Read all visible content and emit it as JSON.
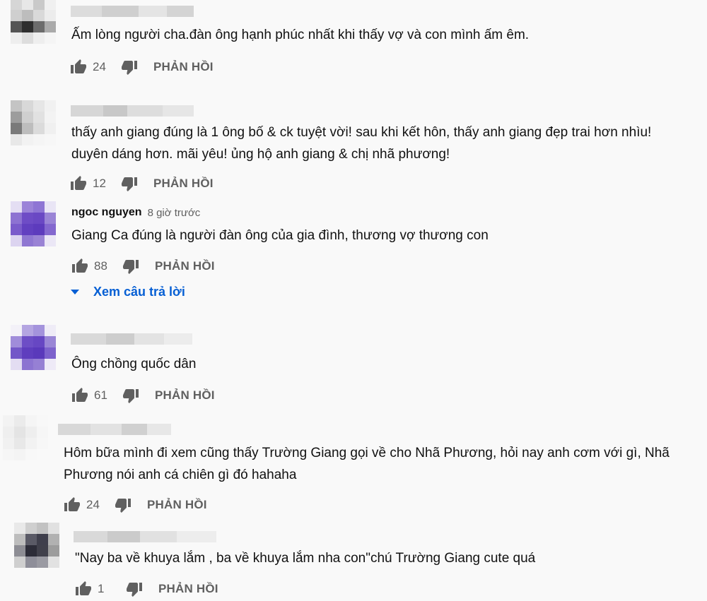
{
  "colors": {
    "text": "#111111",
    "secondary": "#606060",
    "link": "#065fd4",
    "background": "#f9f9f9"
  },
  "icons": {
    "like": "thumbs-up-icon",
    "dislike": "thumbs-down-icon",
    "expand": "caret-down-icon"
  },
  "comments": [
    {
      "author": "",
      "timestamp": "",
      "text": "Ấm lòng người cha.đàn ông hạnh phúc nhất khi thấy vợ và con mình ấm êm.",
      "likes": "24",
      "reply_label": "PHẢN HỒI"
    },
    {
      "author": "",
      "timestamp": "",
      "text": "thấy anh giang đúng là 1 ông bố & ck tuyệt vời! sau khi kết hôn, thấy anh giang đẹp trai hơn nhìu!\nduyên dáng hơn. mãi yêu! ủng hộ anh giang & chị nhã phương!",
      "likes": "12",
      "reply_label": "PHẢN HỒI"
    },
    {
      "author": "ngoc nguyen",
      "timestamp": "8 giờ trước",
      "text": "Giang Ca đúng là người đàn ông của gia đình, thương vợ thương con",
      "likes": "88",
      "reply_label": "PHẢN HỒI",
      "view_replies": "Xem câu trả lời"
    },
    {
      "author": "",
      "timestamp": "",
      "text": "Ông chồng quốc dân",
      "likes": "61",
      "reply_label": "PHẢN HỒI"
    },
    {
      "author": "",
      "timestamp": "",
      "text": "Hôm bữa mình đi xem cũng thấy Trường Giang gọi về cho Nhã Phương, hỏi nay anh cơm với gì, Nhã\nPhương nói anh cá chiên gì đó hahaha",
      "likes": "24",
      "reply_label": "PHẢN HỒI"
    },
    {
      "author": "",
      "timestamp": "",
      "text": "\"Nay ba về khuya lắm , ba về khuya lắm nha con\"chú Trường Giang cute quá",
      "likes": "1",
      "reply_label": "PHẢN HỒI"
    }
  ]
}
